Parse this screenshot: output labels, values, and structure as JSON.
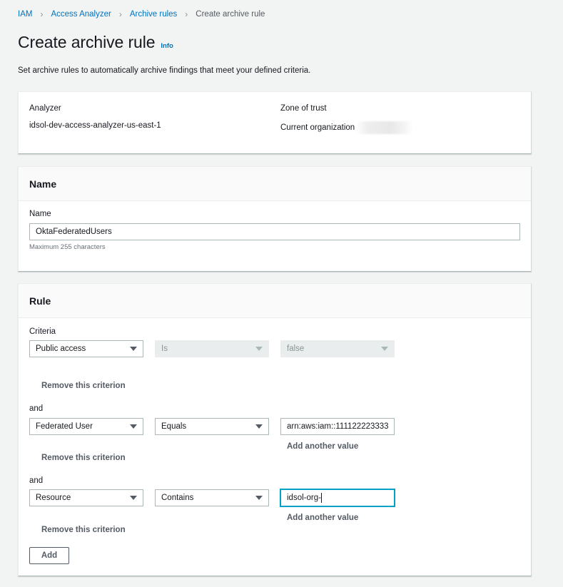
{
  "breadcrumb": {
    "items": [
      {
        "label": "IAM",
        "link": true
      },
      {
        "label": "Access Analyzer",
        "link": true
      },
      {
        "label": "Archive rules",
        "link": true
      },
      {
        "label": "Create archive rule",
        "link": false
      }
    ],
    "separator_icon": "chevron-right-icon"
  },
  "header": {
    "title": "Create archive rule",
    "info_label": "Info",
    "description": "Set archive rules to automatically archive findings that meet your defined criteria."
  },
  "summary": {
    "analyzer_label": "Analyzer",
    "analyzer_value": "idsol-dev-access-analyzer-us-east-1",
    "zone_label": "Zone of trust",
    "zone_value": "Current organization"
  },
  "name_section": {
    "title": "Name",
    "field_label": "Name",
    "field_value": "OktaFederatedUsers",
    "hint": "Maximum 255 characters"
  },
  "rule_section": {
    "title": "Rule",
    "criteria_label": "Criteria",
    "and_label": "and",
    "remove_label": "Remove this criterion",
    "add_value_label": "Add another value",
    "add_button": "Add",
    "criteria": [
      {
        "property": "Public access",
        "operator": "Is",
        "value": "false",
        "operator_disabled": true,
        "value_type": "select"
      },
      {
        "property": "Federated User",
        "operator": "Equals",
        "value": "arn:aws:iam::111122223333",
        "value_type": "input"
      },
      {
        "property": "Resource",
        "operator": "Contains",
        "value": "idsol-org-",
        "value_type": "input",
        "focused": true
      }
    ]
  },
  "colors": {
    "background": "#f2f3f3",
    "link": "#0073bb",
    "focus": "#00a1c9",
    "text": "#16191f",
    "secondary_text": "#545b64"
  }
}
